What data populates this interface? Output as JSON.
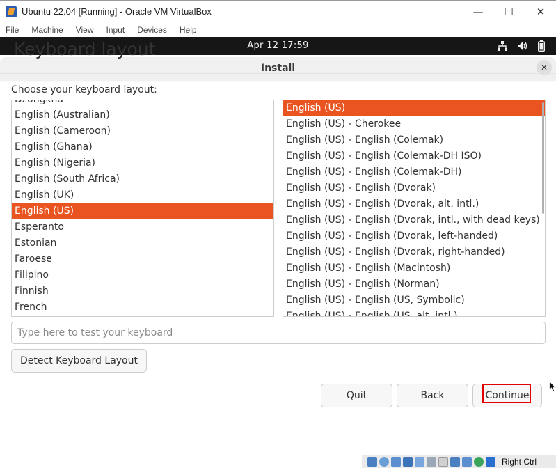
{
  "host_window": {
    "title": "Ubuntu 22.04 [Running] - Oracle VM VirtualBox",
    "minimize": "—",
    "maximize": "☐",
    "close": "✕"
  },
  "host_menu": [
    "File",
    "Machine",
    "View",
    "Input",
    "Devices",
    "Help"
  ],
  "guest_topbar": {
    "clock": "Apr 12  17:59",
    "icons": [
      "network-icon",
      "volume-icon",
      "battery-icon"
    ]
  },
  "dialog": {
    "title": "Install",
    "close_glyph": "✕",
    "heading": "Keyboard layout",
    "choose_label": "Choose your keyboard layout:",
    "layouts": {
      "items": [
        "Dzongkha",
        "English (Australian)",
        "English (Cameroon)",
        "English (Ghana)",
        "English (Nigeria)",
        "English (South Africa)",
        "English (UK)",
        "English (US)",
        "Esperanto",
        "Estonian",
        "Faroese",
        "Filipino",
        "Finnish",
        "French"
      ],
      "selected": "English (US)"
    },
    "variants": {
      "items": [
        "English (US)",
        "English (US) - Cherokee",
        "English (US) - English (Colemak)",
        "English (US) - English (Colemak-DH ISO)",
        "English (US) - English (Colemak-DH)",
        "English (US) - English (Dvorak)",
        "English (US) - English (Dvorak, alt. intl.)",
        "English (US) - English (Dvorak, intl., with dead keys)",
        "English (US) - English (Dvorak, left-handed)",
        "English (US) - English (Dvorak, right-handed)",
        "English (US) - English (Macintosh)",
        "English (US) - English (Norman)",
        "English (US) - English (US, Symbolic)",
        "English (US) - English (US, alt. intl.)"
      ],
      "selected": "English (US)"
    },
    "test_input": {
      "value": "",
      "placeholder": "Type here to test your keyboard"
    },
    "detect_button": "Detect Keyboard Layout",
    "quit_button": "Quit",
    "back_button": "Back",
    "continue_button": "Continue"
  },
  "host_status": {
    "host_key": "Right Ctrl"
  },
  "colors": {
    "accent": "#e95420",
    "topbar": "#161616",
    "highlight": "#e00000"
  }
}
